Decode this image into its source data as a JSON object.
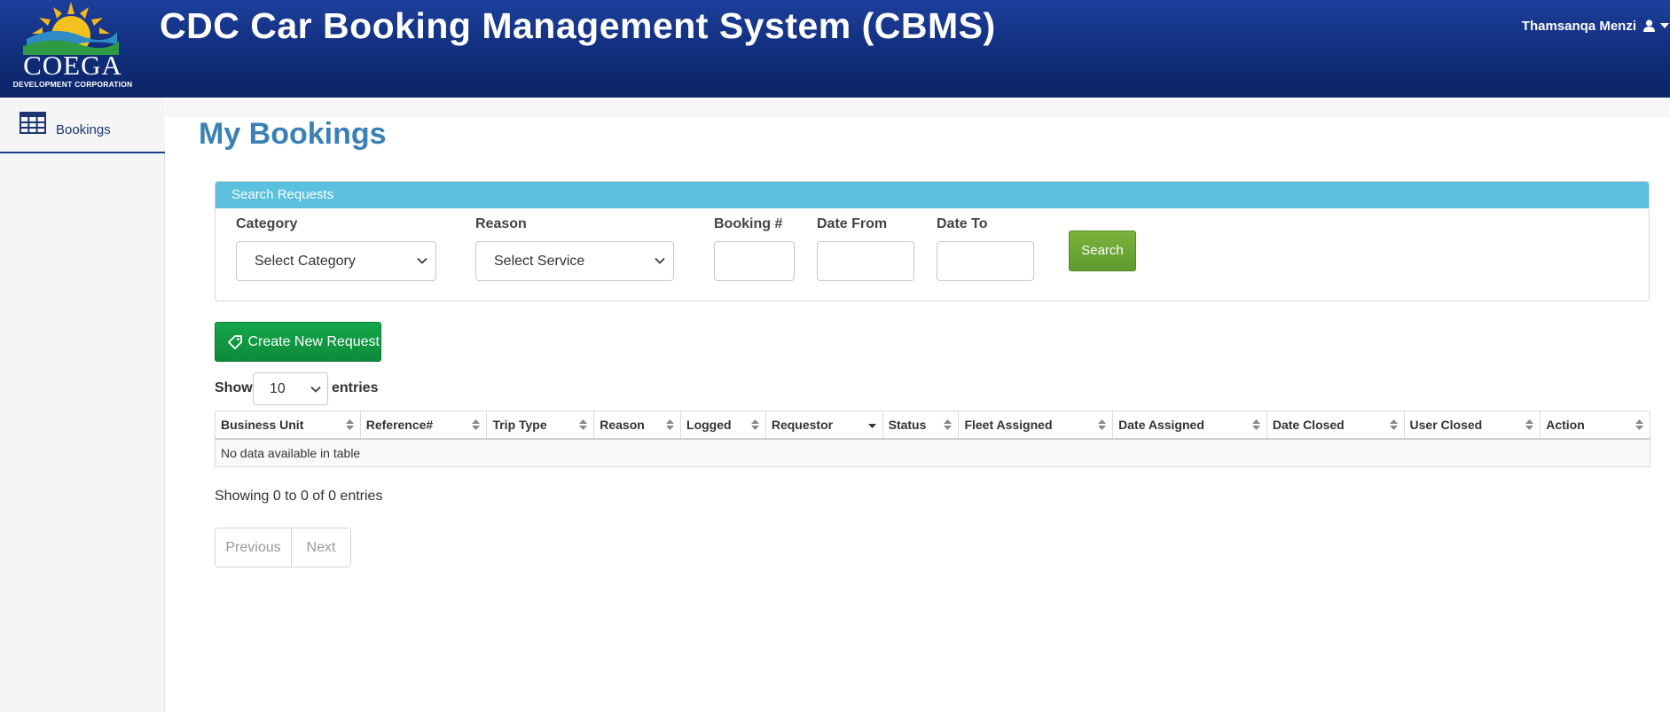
{
  "header": {
    "logo_word": "COEGA",
    "logo_sub": "DEVELOPMENT CORPORATION",
    "title": "CDC Car Booking Management System (CBMS)",
    "user_name": "Thamsanqa Menzi"
  },
  "sidebar": {
    "items": [
      {
        "label": "Bookings",
        "icon": "table-grid-icon"
      }
    ]
  },
  "page": {
    "title": "My Bookings"
  },
  "search": {
    "panel_title": "Search Requests",
    "category_label": "Category",
    "category_value": "Select Category",
    "reason_label": "Reason",
    "reason_value": "Select Service",
    "booking_label": "Booking #",
    "date_from_label": "Date From",
    "date_to_label": "Date To",
    "search_button": "Search"
  },
  "actions": {
    "create_button": "Create New Request"
  },
  "table": {
    "show_label": "Show",
    "page_length": "10",
    "entries_label": "entries",
    "columns": [
      "Business Unit",
      "Reference#",
      "Trip Type",
      "Reason",
      "Logged",
      "Requestor",
      "Status",
      "Fleet Assigned",
      "Date Assigned",
      "Date Closed",
      "User Closed",
      "Action"
    ],
    "empty_message": "No data available in table",
    "info": "Showing 0 to 0 of 0 entries",
    "prev": "Previous",
    "next": "Next"
  },
  "colors": {
    "header": "#0f2c78",
    "panel_head": "#5bc0de",
    "search_button": "#6aa535",
    "create_button": "#109a43",
    "title": "#3a80b6"
  }
}
